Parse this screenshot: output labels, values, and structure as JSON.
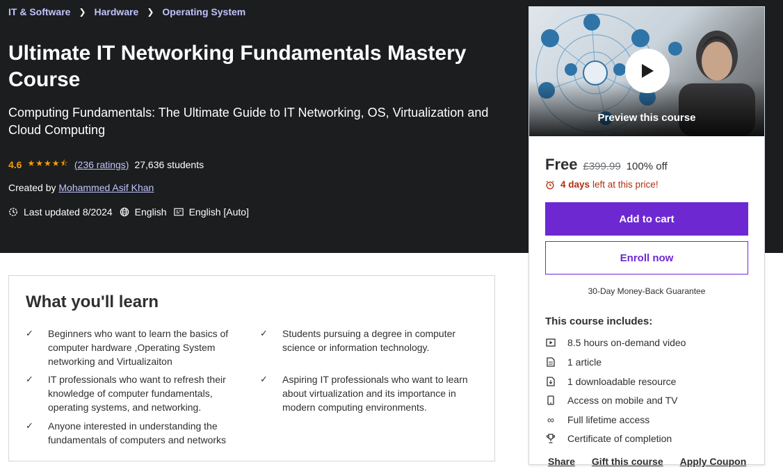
{
  "breadcrumb": [
    "IT & Software",
    "Hardware",
    "Operating System"
  ],
  "course": {
    "title": "Ultimate IT Networking Fundamentals Mastery Course",
    "subtitle": "Computing Fundamentals: The Ultimate Guide to IT Networking, OS, Virtualization and Cloud Computing",
    "rating": "4.6",
    "rating_stars": 4.5,
    "ratings_count": "(236 ratings)",
    "students": "27,636 students",
    "created_by_label": "Created by",
    "instructor": "Mohammed Asif Khan",
    "last_updated": "Last updated 8/2024",
    "language": "English",
    "captions": "English [Auto]"
  },
  "learn": {
    "title": "What you'll learn",
    "items": [
      "Beginners who want to learn the basics of computer hardware ,Operating System networking and Virtualizaiton",
      "Students pursuing a degree in computer science or information technology.",
      "IT professionals who want to refresh their knowledge of computer fundamentals, operating systems, and networking.",
      "Aspiring IT professionals who want to learn about virtualization and its importance in modern computing environments.",
      "Anyone interested in understanding the fundamentals of computers and networks"
    ]
  },
  "sidebar": {
    "preview_label": "Preview this course",
    "price": "Free",
    "original_price": "£399.99",
    "discount": "100% off",
    "urgency_days": "4 days",
    "urgency_rest": "left at this price!",
    "add_to_cart": "Add to cart",
    "enroll_now": "Enroll now",
    "guarantee": "30-Day Money-Back Guarantee",
    "includes_title": "This course includes:",
    "includes": [
      {
        "icon": "video-icon",
        "text": "8.5 hours on-demand video"
      },
      {
        "icon": "article-icon",
        "text": "1 article"
      },
      {
        "icon": "download-file-icon",
        "text": "1 downloadable resource"
      },
      {
        "icon": "mobile-icon",
        "text": "Access on mobile and TV"
      },
      {
        "icon": "infinity-icon",
        "text": "Full lifetime access"
      },
      {
        "icon": "trophy-icon",
        "text": "Certificate of completion"
      }
    ],
    "footer_links": [
      "Share",
      "Gift this course",
      "Apply Coupon"
    ]
  },
  "colors": {
    "hero_bg": "#1c1d1f",
    "link_purple": "#c0c4fc",
    "star_orange": "#f69c08",
    "brand_purple": "#6d28d2",
    "urgency_red": "#b32d0f"
  }
}
